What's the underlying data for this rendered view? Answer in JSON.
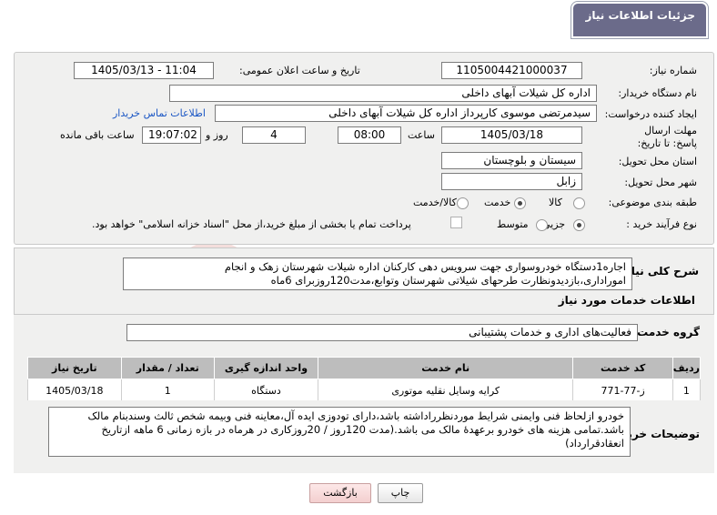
{
  "header": {
    "title": "جزئیات اطلاعات نیاز"
  },
  "form": {
    "need_number_label": "شماره نیاز:",
    "need_number": "1105004421000037",
    "announce_label": "تاریخ و ساعت اعلان عمومی:",
    "announce_value": "1405/03/13 - 11:04",
    "buyer_org_label": "نام دستگاه خریدار:",
    "buyer_org": "اداره کل شیلات آبهای داخلی",
    "creator_label": "ایجاد کننده درخواست:",
    "creator": "سیدمرتضی موسوی کارپرداز اداره کل شیلات آبهای داخلی",
    "contact_link": "اطلاعات تماس خریدار",
    "deadline_label": "مهلت ارسال پاسخ: تا تاریخ:",
    "deadline_date": "1405/03/18",
    "time_label": "ساعت",
    "deadline_time": "08:00",
    "days_value": "4",
    "days_label": "روز و",
    "remaining_time": "19:07:02",
    "remaining_label": "ساعت باقی مانده",
    "province_label": "استان محل تحویل:",
    "province": "سیستان و بلوچستان",
    "city_label": "شهر محل تحویل:",
    "city": "زابل",
    "category_label": "طبقه بندی موضوعی:",
    "category_options": [
      "کالا",
      "خدمت",
      "کالا/خدمت"
    ],
    "category_selected": 1,
    "process_label": "نوع فرآیند خرید :",
    "process_options": [
      "جزیی",
      "متوسط"
    ],
    "process_selected": 0,
    "payment_note": "پرداخت تمام یا بخشی از مبلغ خرید،از محل \"اسناد خزانه اسلامی\" خواهد بود."
  },
  "description": {
    "label": "شرح کلی نیاز:",
    "text": "اجاره1دستگاه خودروسواری جهت سرویس دهی کارکنان اداره شیلات شهرستان زهک و انجام اموراداری،بازدیدونظارت طرحهای شیلاتی شهرستان وتوابع،مدت120روزبرای 6ماه"
  },
  "services": {
    "section_title": "اطلاعات خدمات مورد نیاز",
    "group_label": "گروه خدمت:",
    "group_value": "فعالیت‌های اداری و خدمات پشتیبانی",
    "columns": [
      "ردیف",
      "کد خدمت",
      "نام خدمت",
      "واحد اندازه گیری",
      "تعداد / مقدار",
      "تاریخ نیاز"
    ],
    "rows": [
      [
        "1",
        "ز-77-771",
        "کرایه وسایل نقلیه موتوری",
        "دستگاه",
        "1",
        "1405/03/18"
      ]
    ]
  },
  "notes": {
    "label": "توضیحات خریدار:",
    "text": "خودرو ازلحاظ فنی وایمنی شرایط موردنظرراداشته باشد،دارای تودوزی ایده آل،معاینه فنی وبیمه شخص ثالث وسندبنام مالک باشد.تمامی هزینه های خودرو برعهدۀ مالک می باشد.(مدت 120روز / 20روزکاری در هرماه در بازه زمانی 6 ماهه ازتاریخ انعقادقرارداد)"
  },
  "buttons": {
    "print": "چاپ",
    "back": "بازگشت"
  },
  "colors": {
    "header_tab": "#6b6b8a",
    "link": "#1a56c4",
    "back_button": "#f8d7d7"
  }
}
